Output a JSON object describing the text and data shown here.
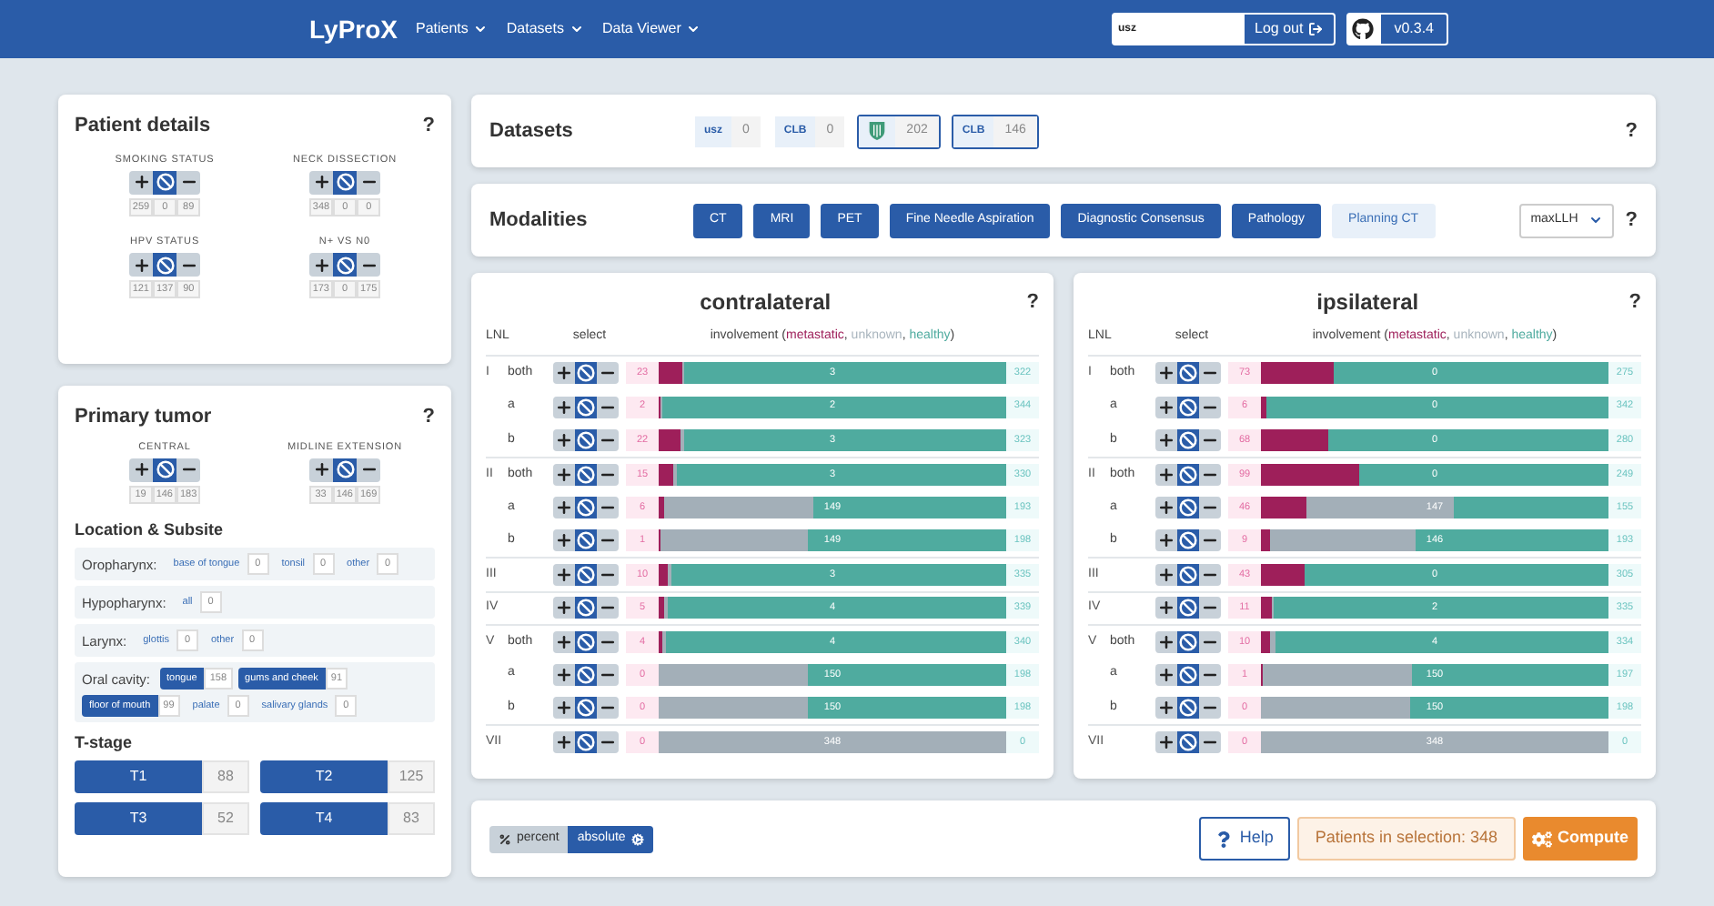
{
  "navbar": {
    "logo": "LyProX",
    "menus": [
      "Patients",
      "Datasets",
      "Data Viewer"
    ],
    "user": "usz",
    "logout": "Log out",
    "version": "v0.3.4"
  },
  "patient_details": {
    "title": "Patient details",
    "help": "?",
    "filters": [
      {
        "label": "SMOKING STATUS",
        "include": false,
        "ignore": true,
        "exclude": false,
        "counts": [
          "259",
          "0",
          "89"
        ]
      },
      {
        "label": "NECK DISSECTION",
        "include": false,
        "ignore": true,
        "exclude": false,
        "counts": [
          "348",
          "0",
          "0"
        ]
      },
      {
        "label": "HPV STATUS",
        "include": false,
        "ignore": true,
        "exclude": false,
        "counts": [
          "121",
          "137",
          "90"
        ]
      },
      {
        "label": "N+ VS N0",
        "include": false,
        "ignore": true,
        "exclude": false,
        "counts": [
          "173",
          "0",
          "175"
        ]
      }
    ]
  },
  "primary_tumor": {
    "title": "Primary tumor",
    "help": "?",
    "filters": [
      {
        "label": "CENTRAL",
        "include": false,
        "ignore": true,
        "exclude": false,
        "counts": [
          "19",
          "146",
          "183"
        ]
      },
      {
        "label": "MIDLINE EXTENSION",
        "include": false,
        "ignore": true,
        "exclude": false,
        "counts": [
          "33",
          "146",
          "169"
        ]
      }
    ],
    "location_title": "Location & Subsite",
    "locations": [
      {
        "label": "Oropharynx:",
        "subsites": [
          {
            "label": "base of tongue",
            "count": "0",
            "selected": false
          },
          {
            "label": "tonsil",
            "count": "0",
            "selected": false
          },
          {
            "label": "other",
            "count": "0",
            "selected": false
          }
        ]
      },
      {
        "label": "Hypopharynx:",
        "subsites": [
          {
            "label": "all",
            "count": "0",
            "selected": false
          }
        ]
      },
      {
        "label": "Larynx:",
        "subsites": [
          {
            "label": "glottis",
            "count": "0",
            "selected": false
          },
          {
            "label": "other",
            "count": "0",
            "selected": false
          }
        ]
      },
      {
        "label": "Oral cavity:",
        "subsites": [
          {
            "label": "tongue",
            "count": "158",
            "selected": true
          },
          {
            "label": "gums and cheek",
            "count": "91",
            "selected": true
          },
          {
            "label": "floor of mouth",
            "count": "99",
            "selected": true
          },
          {
            "label": "palate",
            "count": "0",
            "selected": false
          },
          {
            "label": "salivary glands",
            "count": "0",
            "selected": false
          }
        ]
      }
    ],
    "tstage_title": "T-stage",
    "tstages": [
      {
        "label": "T1",
        "count": "88",
        "selected": true
      },
      {
        "label": "T2",
        "count": "125",
        "selected": true
      },
      {
        "label": "T3",
        "count": "52",
        "selected": true
      },
      {
        "label": "T4",
        "count": "83",
        "selected": true
      }
    ]
  },
  "datasets": {
    "title": "Datasets",
    "help": "?",
    "items": [
      {
        "kind": "text",
        "label": "usz",
        "count": "0",
        "selected": false
      },
      {
        "kind": "text",
        "label": "CLB",
        "count": "0",
        "selected": false
      },
      {
        "kind": "shield",
        "count": "202",
        "selected": true
      },
      {
        "kind": "text",
        "label": "CLB",
        "count": "146",
        "selected": true
      }
    ]
  },
  "modalities": {
    "title": "Modalities",
    "help": "?",
    "items": [
      {
        "label": "CT",
        "selected": true
      },
      {
        "label": "MRI",
        "selected": true
      },
      {
        "label": "PET",
        "selected": true
      },
      {
        "label": "Fine Needle Aspiration",
        "selected": true
      },
      {
        "label": "Diagnostic Consensus",
        "selected": true
      },
      {
        "label": "Pathology",
        "selected": true
      },
      {
        "label": "Planning CT",
        "selected": false
      }
    ],
    "method": "maxLLH"
  },
  "sides": [
    {
      "title": "contralateral",
      "help": "?",
      "columns": [
        "LNL",
        "select"
      ],
      "involvement": "involvement (",
      "legend": [
        {
          "label": "metastatic",
          "color": "#9e1f5a",
          "after": ", "
        },
        {
          "label": "unknown",
          "color": "#a9b5be",
          "after": ", "
        },
        {
          "label": "healthy",
          "color": "#4fab9f",
          "after": ")"
        }
      ],
      "rows": [
        {
          "lnl": "I",
          "sub": "both",
          "include": false,
          "ignore": true,
          "exclude": false,
          "metastatic": "23",
          "unknown": "3",
          "healthy": "322"
        },
        {
          "sub": "a",
          "include": false,
          "ignore": true,
          "exclude": false,
          "metastatic": "2",
          "unknown": "2",
          "healthy": "344"
        },
        {
          "sub": "b",
          "include": false,
          "ignore": true,
          "exclude": false,
          "metastatic": "22",
          "unknown": "3",
          "healthy": "323"
        },
        {
          "lnl": "II",
          "sub": "both",
          "include": false,
          "ignore": true,
          "exclude": false,
          "metastatic": "15",
          "unknown": "3",
          "healthy": "330"
        },
        {
          "sub": "a",
          "include": false,
          "ignore": true,
          "exclude": false,
          "metastatic": "6",
          "unknown": "149",
          "healthy": "193"
        },
        {
          "sub": "b",
          "include": false,
          "ignore": true,
          "exclude": false,
          "metastatic": "1",
          "unknown": "149",
          "healthy": "198"
        },
        {
          "lnl": "III",
          "include": false,
          "ignore": true,
          "exclude": false,
          "metastatic": "10",
          "unknown": "3",
          "healthy": "335"
        },
        {
          "lnl": "IV",
          "include": false,
          "ignore": true,
          "exclude": false,
          "metastatic": "5",
          "unknown": "4",
          "healthy": "339"
        },
        {
          "lnl": "V",
          "sub": "both",
          "include": false,
          "ignore": true,
          "exclude": false,
          "metastatic": "4",
          "unknown": "4",
          "healthy": "340"
        },
        {
          "sub": "a",
          "include": false,
          "ignore": true,
          "exclude": false,
          "metastatic": "0",
          "unknown": "150",
          "healthy": "198"
        },
        {
          "sub": "b",
          "include": false,
          "ignore": true,
          "exclude": false,
          "metastatic": "0",
          "unknown": "150",
          "healthy": "198"
        },
        {
          "lnl": "VII",
          "include": false,
          "ignore": true,
          "exclude": false,
          "metastatic": "0",
          "unknown": "348",
          "healthy": "0"
        }
      ]
    },
    {
      "title": "ipsilateral",
      "help": "?",
      "columns": [
        "LNL",
        "select"
      ],
      "involvement": "involvement (",
      "legend": [
        {
          "label": "metastatic",
          "color": "#9e1f5a",
          "after": ", "
        },
        {
          "label": "unknown",
          "color": "#a9b5be",
          "after": ", "
        },
        {
          "label": "healthy",
          "color": "#4fab9f",
          "after": ")"
        }
      ],
      "rows": [
        {
          "lnl": "I",
          "sub": "both",
          "include": false,
          "ignore": true,
          "exclude": false,
          "metastatic": "73",
          "unknown": "0",
          "healthy": "275"
        },
        {
          "sub": "a",
          "include": false,
          "ignore": true,
          "exclude": false,
          "metastatic": "6",
          "unknown": "0",
          "healthy": "342"
        },
        {
          "sub": "b",
          "include": false,
          "ignore": true,
          "exclude": false,
          "metastatic": "68",
          "unknown": "0",
          "healthy": "280"
        },
        {
          "lnl": "II",
          "sub": "both",
          "include": false,
          "ignore": true,
          "exclude": false,
          "metastatic": "99",
          "unknown": "0",
          "healthy": "249"
        },
        {
          "sub": "a",
          "include": false,
          "ignore": true,
          "exclude": false,
          "metastatic": "46",
          "unknown": "147",
          "healthy": "155"
        },
        {
          "sub": "b",
          "include": false,
          "ignore": true,
          "exclude": false,
          "metastatic": "9",
          "unknown": "146",
          "healthy": "193"
        },
        {
          "lnl": "III",
          "include": false,
          "ignore": true,
          "exclude": false,
          "metastatic": "43",
          "unknown": "0",
          "healthy": "305"
        },
        {
          "lnl": "IV",
          "include": false,
          "ignore": true,
          "exclude": false,
          "metastatic": "11",
          "unknown": "2",
          "healthy": "335"
        },
        {
          "lnl": "V",
          "sub": "both",
          "include": false,
          "ignore": true,
          "exclude": false,
          "metastatic": "10",
          "unknown": "4",
          "healthy": "334"
        },
        {
          "sub": "a",
          "include": false,
          "ignore": true,
          "exclude": false,
          "metastatic": "1",
          "unknown": "150",
          "healthy": "197"
        },
        {
          "sub": "b",
          "include": false,
          "ignore": true,
          "exclude": false,
          "metastatic": "0",
          "unknown": "150",
          "healthy": "198"
        },
        {
          "lnl": "VII",
          "include": false,
          "ignore": true,
          "exclude": false,
          "metastatic": "0",
          "unknown": "348",
          "healthy": "0"
        }
      ]
    }
  ],
  "bottom": {
    "display": [
      {
        "label": "percent",
        "kind": "percent",
        "selected": false
      },
      {
        "label": "absolute",
        "kind": "absolute",
        "selected": true
      }
    ],
    "help": "Help",
    "selection": "Patients in selection: 348",
    "compute": "Compute"
  }
}
